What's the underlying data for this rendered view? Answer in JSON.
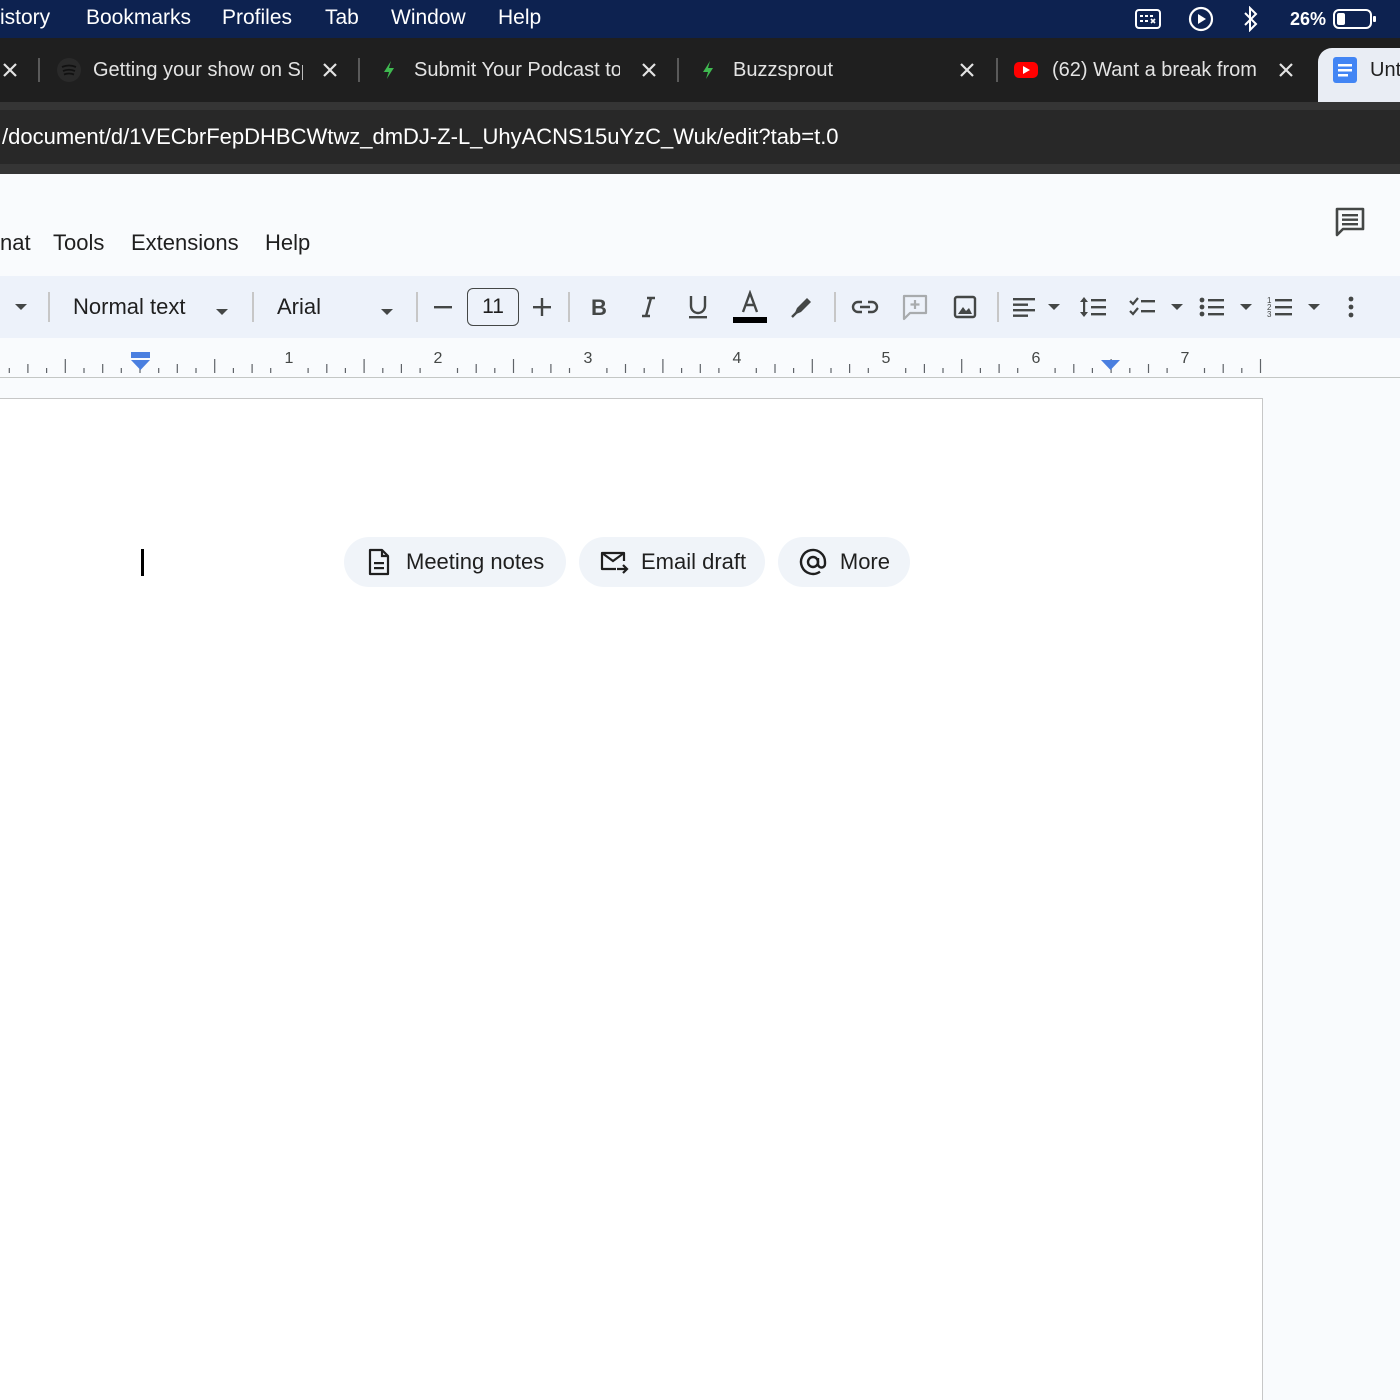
{
  "os_menubar": {
    "items": [
      "istory",
      "Bookmarks",
      "Profiles",
      "Tab",
      "Window",
      "Help"
    ],
    "battery_percent": "26%",
    "battery_level": 0.26,
    "status_icons": [
      "keyboard-icon",
      "play-circle-icon",
      "bluetooth-icon",
      "battery-icon"
    ]
  },
  "browser": {
    "tabs": [
      {
        "title": "Getting your show on Sp",
        "favicon": "spotify-icon"
      },
      {
        "title": "Submit Your Podcast to",
        "favicon": "buzzsprout-icon"
      },
      {
        "title": "Buzzsprout",
        "favicon": "buzzsprout-icon"
      },
      {
        "title": "(62) Want a break from",
        "favicon": "youtube-icon"
      },
      {
        "title": "Unt",
        "favicon": "docs-icon",
        "active": true
      }
    ],
    "url": "/document/d/1VECbrFepDHBCWtwz_dmDJ-Z-L_UhyACNS15uYzC_Wuk/edit?tab=t.0"
  },
  "docs": {
    "menu": [
      "nat",
      "Tools",
      "Extensions",
      "Help"
    ],
    "toolbar": {
      "paragraph_style": "Normal text",
      "font": "Arial",
      "font_size": "11"
    },
    "ruler_labels": [
      "1",
      "2",
      "3",
      "4",
      "5",
      "6",
      "7"
    ],
    "chips": [
      {
        "label": "Meeting notes",
        "icon": "document-icon"
      },
      {
        "label": "Email draft",
        "icon": "email-draft-icon"
      },
      {
        "label": "More",
        "icon": "at-sign-icon"
      }
    ]
  },
  "colors": {
    "menubar_bg": "#0d2250",
    "tabstrip_bg": "#1f1f1f",
    "docs_toolbar_bg": "#edf2fa",
    "ruler_indent_blue": "#4a7fe0",
    "spotify": "#1db954",
    "youtube": "#ff0000",
    "docs_blue": "#4285f4"
  }
}
